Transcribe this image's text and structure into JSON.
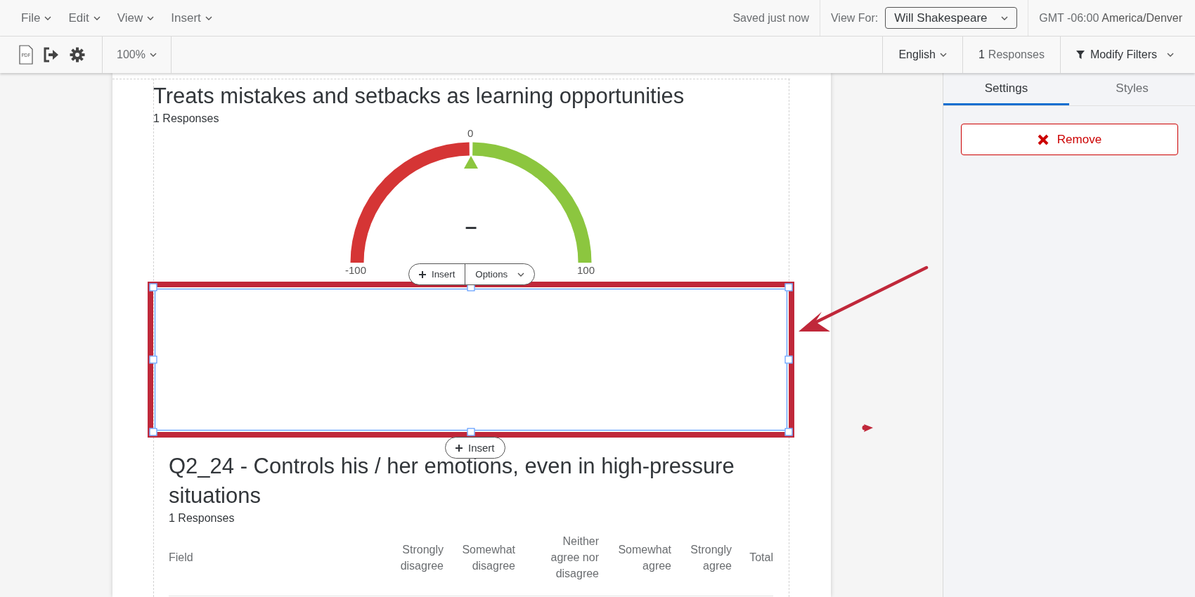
{
  "menu_bar": {
    "menus": [
      "File",
      "Edit",
      "View",
      "Insert"
    ],
    "save_status": "Saved just now",
    "view_for": {
      "label": "View For:",
      "value": "Will Shakespeare"
    },
    "timezone": {
      "offset": "GMT -06:00",
      "zone": "America/Denver"
    }
  },
  "toolbar": {
    "pdf_icon_text": "PDF",
    "zoom": "100%",
    "language": "English",
    "responses": {
      "count": "1",
      "label": "Responses"
    },
    "filters": "Modify Filters"
  },
  "report": {
    "widgets": [
      {
        "kind": "gauge",
        "title": "Treats mistakes and setbacks as learning opportunities",
        "responses": "1 Responses",
        "gauge": {
          "value": "–",
          "min_label": "-100",
          "mid_label": "0",
          "max_label": "100"
        },
        "insert_label": "Insert",
        "options_label": "Options"
      },
      {
        "kind": "blank",
        "selected": true,
        "insert_label": "Insert"
      },
      {
        "kind": "table",
        "title": "Q2_24 - Controls his / her emotions, even in high-pressure situations",
        "responses": "1 Responses",
        "columns": [
          "Field",
          "Strongly disagree",
          "Somewhat disagree",
          "Neither agree nor disagree",
          "Somewhat agree",
          "Strongly agree",
          "Total"
        ]
      }
    ]
  },
  "side_panel": {
    "tabs": [
      {
        "label": "Settings",
        "selected": true
      },
      {
        "label": "Styles",
        "selected": false
      }
    ],
    "remove_button": "Remove"
  }
}
